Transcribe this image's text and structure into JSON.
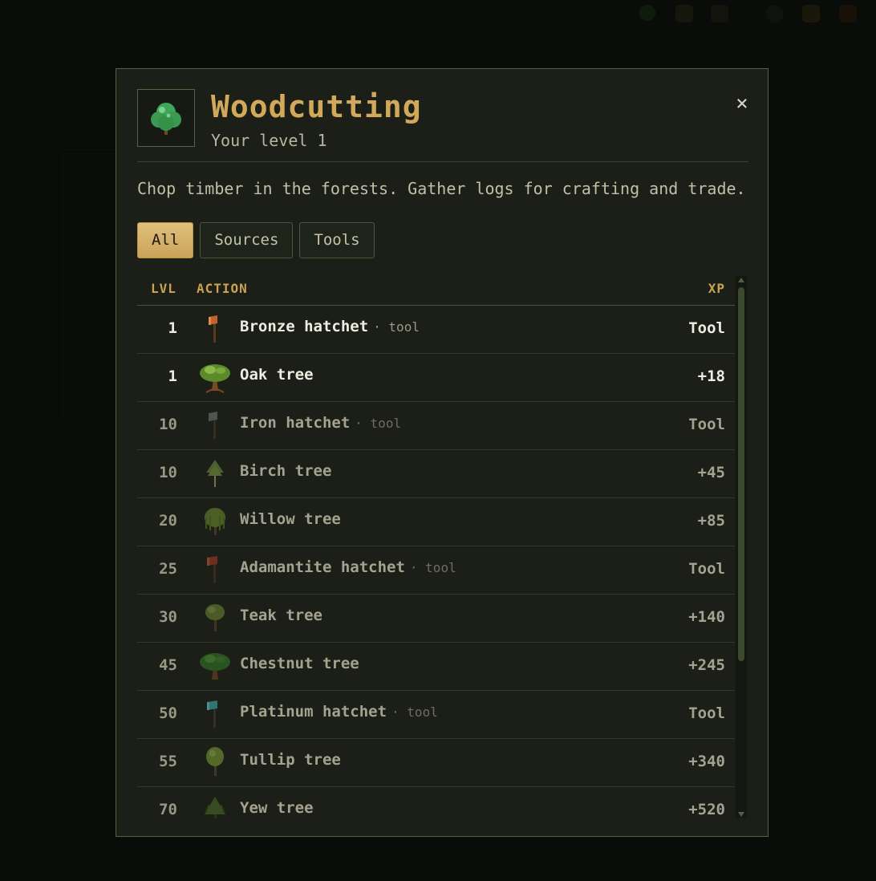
{
  "modal": {
    "title": "Woodcutting",
    "subtitle": "Your level 1",
    "close_label": "×",
    "description": "Chop timber in the forests. Gather logs for crafting and trade.",
    "skill_icon": "tree-icon"
  },
  "tabs": [
    {
      "label": "All",
      "active": true
    },
    {
      "label": "Sources",
      "active": false
    },
    {
      "label": "Tools",
      "active": false
    }
  ],
  "table": {
    "headers": {
      "lvl": "LVL",
      "action": "ACTION",
      "xp": "XP"
    },
    "rows": [
      {
        "lvl": "1",
        "name": "Bronze hatchet",
        "tag": "· tool",
        "xp": "Tool",
        "icon": "bronze-hatchet-icon",
        "unlocked": true
      },
      {
        "lvl": "1",
        "name": "Oak tree",
        "tag": "",
        "xp": "+18",
        "icon": "oak-tree-icon",
        "unlocked": true
      },
      {
        "lvl": "10",
        "name": "Iron hatchet",
        "tag": "· tool",
        "xp": "Tool",
        "icon": "iron-hatchet-icon",
        "unlocked": false
      },
      {
        "lvl": "10",
        "name": "Birch tree",
        "tag": "",
        "xp": "+45",
        "icon": "birch-tree-icon",
        "unlocked": false
      },
      {
        "lvl": "20",
        "name": "Willow tree",
        "tag": "",
        "xp": "+85",
        "icon": "willow-tree-icon",
        "unlocked": false
      },
      {
        "lvl": "25",
        "name": "Adamantite hatchet",
        "tag": "· tool",
        "xp": "Tool",
        "icon": "adamantite-hatchet-icon",
        "unlocked": false
      },
      {
        "lvl": "30",
        "name": "Teak tree",
        "tag": "",
        "xp": "+140",
        "icon": "teak-tree-icon",
        "unlocked": false
      },
      {
        "lvl": "45",
        "name": "Chestnut tree",
        "tag": "",
        "xp": "+245",
        "icon": "chestnut-tree-icon",
        "unlocked": false
      },
      {
        "lvl": "50",
        "name": "Platinum hatchet",
        "tag": "· tool",
        "xp": "Tool",
        "icon": "platinum-hatchet-icon",
        "unlocked": false
      },
      {
        "lvl": "55",
        "name": "Tullip tree",
        "tag": "",
        "xp": "+340",
        "icon": "tullip-tree-icon",
        "unlocked": false
      },
      {
        "lvl": "70",
        "name": "Yew tree",
        "tag": "",
        "xp": "+520",
        "icon": "yew-tree-icon",
        "unlocked": false
      }
    ]
  },
  "colors": {
    "accent": "#d2a85a",
    "modal_bg": "#1b1f17",
    "border": "#57603f"
  }
}
